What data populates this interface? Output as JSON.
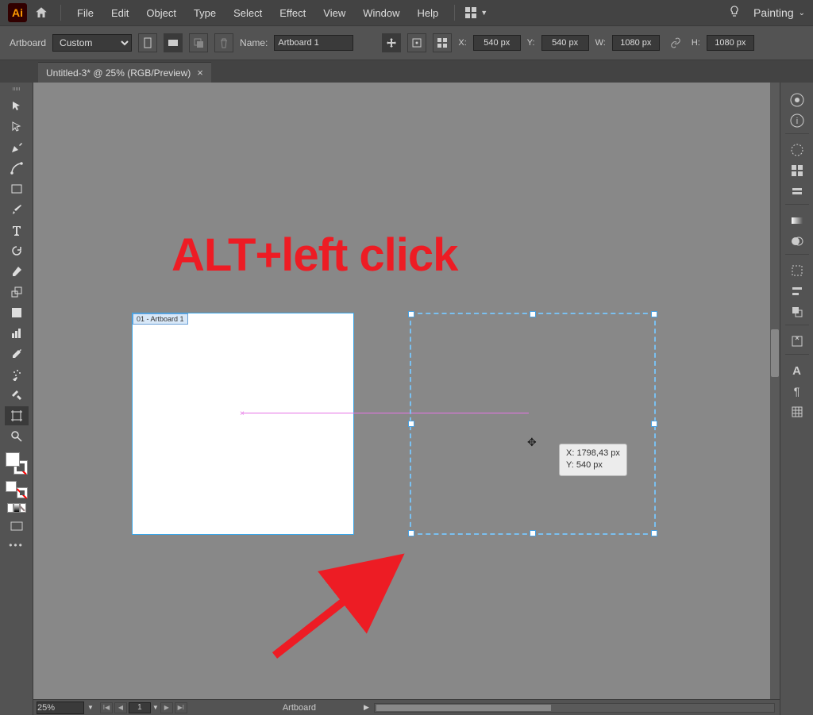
{
  "app": {
    "logo": "Ai"
  },
  "menu": [
    "File",
    "Edit",
    "Object",
    "Type",
    "Select",
    "Effect",
    "View",
    "Window",
    "Help"
  ],
  "workspace": "Painting",
  "options": {
    "tool_label": "Artboard",
    "preset": "Custom",
    "name_label": "Name:",
    "name_value": "Artboard 1",
    "x_label": "X:",
    "x_value": "540 px",
    "y_label": "Y:",
    "y_value": "540 px",
    "w_label": "W:",
    "w_value": "1080 px",
    "h_label": "H:",
    "h_value": "1080 px"
  },
  "tab": {
    "title": "Untitled-3* @ 25% (RGB/Preview)"
  },
  "artboard": {
    "label": "01 - Artboard 1"
  },
  "tooltip": {
    "line1": "X: 1798,43 px",
    "line2": "Y: 540 px"
  },
  "annotation": "ALT+left click",
  "status": {
    "zoom": "25%",
    "page": "1",
    "artboard_label": "Artboard"
  }
}
